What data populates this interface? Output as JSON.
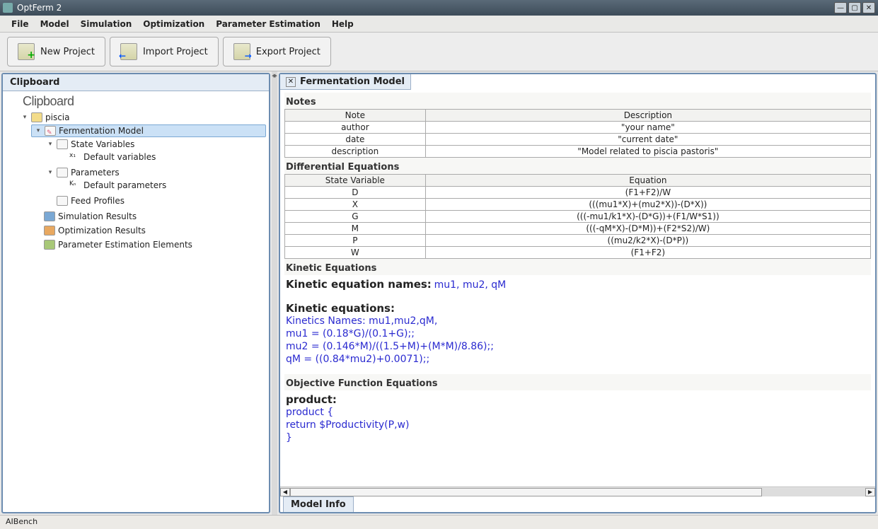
{
  "window": {
    "title": "OptFerm 2"
  },
  "menu": [
    "File",
    "Model",
    "Simulation",
    "Optimization",
    "Parameter Estimation",
    "Help"
  ],
  "toolbar": {
    "new_project": "New Project",
    "import_project": "Import Project",
    "export_project": "Export Project"
  },
  "left": {
    "tab": "Clipboard",
    "heading": "Clipboard",
    "tree": {
      "root": "piscia",
      "model": "Fermentation Model",
      "state_vars": "State Variables",
      "default_vars": "Default variables",
      "parameters": "Parameters",
      "default_params": "Default parameters",
      "feed_profiles": "Feed Profiles",
      "sim_results": "Simulation Results",
      "opt_results": "Optimization Results",
      "param_est": "Parameter Estimation Elements"
    }
  },
  "right": {
    "tab": "Fermentation Model",
    "notes": {
      "title": "Notes",
      "headers": [
        "Note",
        "Description"
      ],
      "rows": [
        [
          "author",
          "\"your name\""
        ],
        [
          "date",
          "\"current date\""
        ],
        [
          "description",
          "\"Model related to piscia pastoris\""
        ]
      ]
    },
    "diffeq": {
      "title": "Differential Equations",
      "headers": [
        "State Variable",
        "Equation"
      ],
      "rows": [
        [
          "D",
          "(F1+F2)/W"
        ],
        [
          "X",
          "(((mu1*X)+(mu2*X))-(D*X))"
        ],
        [
          "G",
          "(((-mu1/k1*X)-(D*G))+(F1/W*S1))"
        ],
        [
          "M",
          "(((-qM*X)-(D*M))+(F2*S2)/W)"
        ],
        [
          "P",
          "((mu2/k2*X)-(D*P))"
        ],
        [
          "W",
          "(F1+F2)"
        ]
      ]
    },
    "kinetic": {
      "title": "Kinetic Equations",
      "names_label": "Kinetic equation names:",
      "names": "mu1, mu2, qM",
      "eq_label": "Kinetic equations:",
      "lines": [
        "Kinetics Names: mu1,mu2,qM,",
        "mu1 = (0.18*G)/(0.1+G);;",
        "mu2 = (0.146*M)/((1.5+M)+(M*M)/8.86);;",
        "qM = ((0.84*mu2)+0.0071);;"
      ]
    },
    "objective": {
      "title": "Objective Function Equations",
      "label": "product:",
      "lines": [
        "product    {",
        "return $Productivity(P,w)",
        "}"
      ]
    },
    "bottom_tab": "Model Info"
  },
  "status": "AIBench"
}
